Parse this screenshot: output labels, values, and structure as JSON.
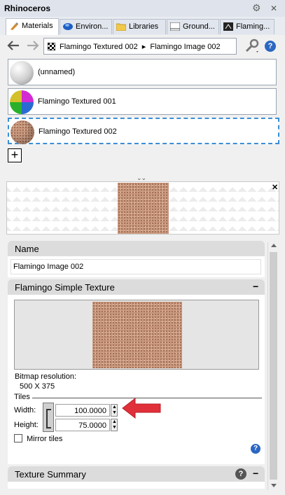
{
  "window": {
    "title": "Rhinoceros"
  },
  "tabs": [
    {
      "label": "Materials",
      "active": true
    },
    {
      "label": "Environ...",
      "active": false
    },
    {
      "label": "Libraries",
      "active": false
    },
    {
      "label": "Ground...",
      "active": false
    },
    {
      "label": "Flaming...",
      "active": false
    }
  ],
  "breadcrumb": {
    "part1": "Flamingo Textured 002",
    "separator": "▸",
    "part2": "Flamingo Image 002"
  },
  "materials": [
    {
      "label": "(unnamed)"
    },
    {
      "label": "Flamingo Textured 001"
    },
    {
      "label": "Flamingo Textured 002",
      "selected": true
    }
  ],
  "add_button": "+",
  "name_section": {
    "title": "Name",
    "value": "Flamingo Image 002"
  },
  "texture_section": {
    "title": "Flamingo Simple Texture",
    "bitmap_label": "Bitmap resolution:",
    "bitmap_value": "500 X 375",
    "tiles_label": "Tiles",
    "width_label": "Width:",
    "width_value": "100.0000",
    "height_label": "Height:",
    "height_value": "75.0000",
    "mirror_label": "Mirror tiles"
  },
  "summary_section": {
    "title": "Texture Summary"
  },
  "colors": {
    "accent": "#3b8fd6",
    "arrow": "#e0303a",
    "help": "#2c67c2"
  }
}
